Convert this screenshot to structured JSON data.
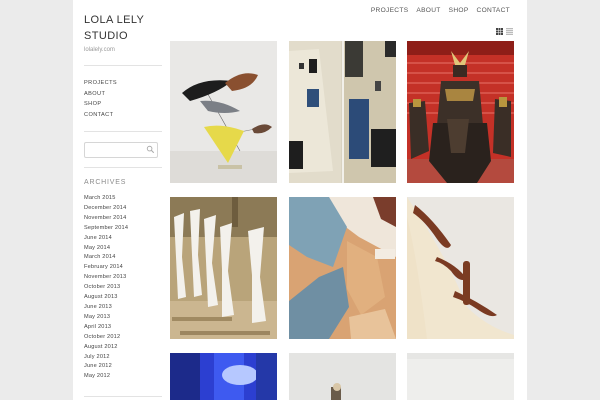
{
  "site": {
    "title": "LOLA LELY STUDIO",
    "url": "lolalely.com"
  },
  "top_nav": [
    "PROJECTS",
    "ABOUT",
    "SHOP",
    "CONTACT"
  ],
  "side_nav": [
    "PROJECTS",
    "ABOUT",
    "SHOP",
    "CONTACT"
  ],
  "search": {
    "placeholder": ""
  },
  "archives": {
    "title": "ARCHIVES",
    "items": [
      "March 2015",
      "December 2014",
      "November 2014",
      "September 2014",
      "June 2014",
      "May 2014",
      "March 2014",
      "February 2014",
      "November 2013",
      "October 2013",
      "August 2013",
      "June 2013",
      "May 2013",
      "April 2013",
      "October 2012",
      "August 2012",
      "July 2012",
      "June 2012",
      "May 2012"
    ]
  },
  "icons": {
    "grid_view": "grid-view-icon",
    "list_view": "list-view-icon",
    "search": "search-icon"
  },
  "gallery": [
    "mobile-sculpture",
    "textile-collage",
    "samurai-on-horse",
    "model-figures",
    "felt-cutouts",
    "wood-inlay-curve",
    "blue-light",
    "small-object",
    "white-surface"
  ]
}
